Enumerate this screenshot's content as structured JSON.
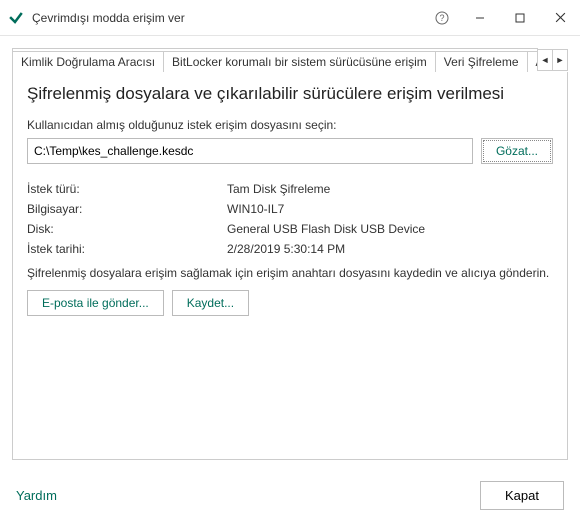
{
  "window": {
    "title": "Çevrimdışı modda erişim ver"
  },
  "tabs": {
    "t0": "Kimlik Doğrulama Aracısı",
    "t1": "BitLocker korumalı bir sistem sürücüsüne erişim",
    "t2": "Veri Şifreleme",
    "t3": "Aygıt De"
  },
  "panel": {
    "heading": "Şifrelenmiş dosyalara ve çıkarılabilir sürücülere erişim verilmesi",
    "select_label": "Kullanıcıdan almış olduğunuz istek erişim dosyasını seçin:",
    "file_value": "C:\\Temp\\kes_challenge.kesdc",
    "browse": "Gözat...",
    "kv": {
      "k0": "İstek türü:",
      "v0": "Tam Disk Şifreleme",
      "k1": "Bilgisayar:",
      "v1": "WIN10-IL7",
      "k2": "Disk:",
      "v2": "General USB Flash Disk USB Device",
      "k3": "İstek tarihi:",
      "v3": "2/28/2019 5:30:14 PM"
    },
    "instruction": "Şifrelenmiş dosyalara erişim sağlamak için erişim anahtarı dosyasını kaydedin ve alıcıya gönderin.",
    "email_btn": "E-posta ile gönder...",
    "save_btn": "Kaydet..."
  },
  "footer": {
    "help": "Yardım",
    "close": "Kapat"
  }
}
